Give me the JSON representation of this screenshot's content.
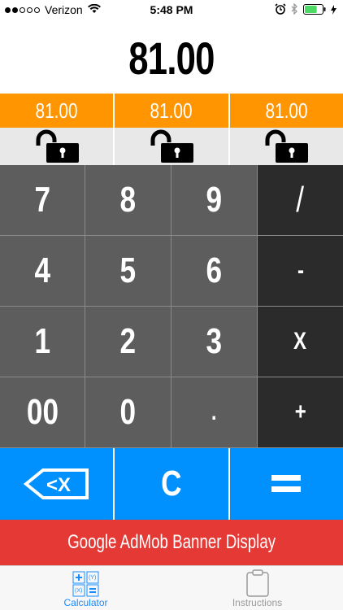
{
  "status_bar": {
    "carrier": "Verizon",
    "time": "5:48 PM",
    "signal_dots_filled": 2,
    "signal_dots_total": 5,
    "battery_level": 0.7
  },
  "display": {
    "value": "81.00"
  },
  "memory": [
    {
      "value": "81.00",
      "lock_icon": "unlocked-padlock-icon"
    },
    {
      "value": "81.00",
      "lock_icon": "unlocked-padlock-icon"
    },
    {
      "value": "81.00",
      "lock_icon": "unlocked-padlock-icon"
    }
  ],
  "keypad": {
    "rows": [
      [
        "7",
        "8",
        "9",
        "/"
      ],
      [
        "4",
        "5",
        "6",
        "-"
      ],
      [
        "1",
        "2",
        "3",
        "X"
      ],
      [
        "00",
        "0",
        ".",
        "+"
      ]
    ]
  },
  "actions": {
    "backspace_icon": "backspace-icon",
    "clear": "C",
    "equals_icon": "equals-icon"
  },
  "ad": {
    "text": "Google AdMob Banner Display"
  },
  "tabs": [
    {
      "label": "Calculator",
      "icon": "calculator-icon",
      "active": true
    },
    {
      "label": "Instructions",
      "icon": "clipboard-icon",
      "active": false
    }
  ],
  "colors": {
    "memory": "#ff9500",
    "digit_key": "#5d5d5d",
    "operator_key": "#2b2b2b",
    "action": "#0091ff",
    "ad": "#e53935",
    "tab_active": "#1a8cff"
  }
}
